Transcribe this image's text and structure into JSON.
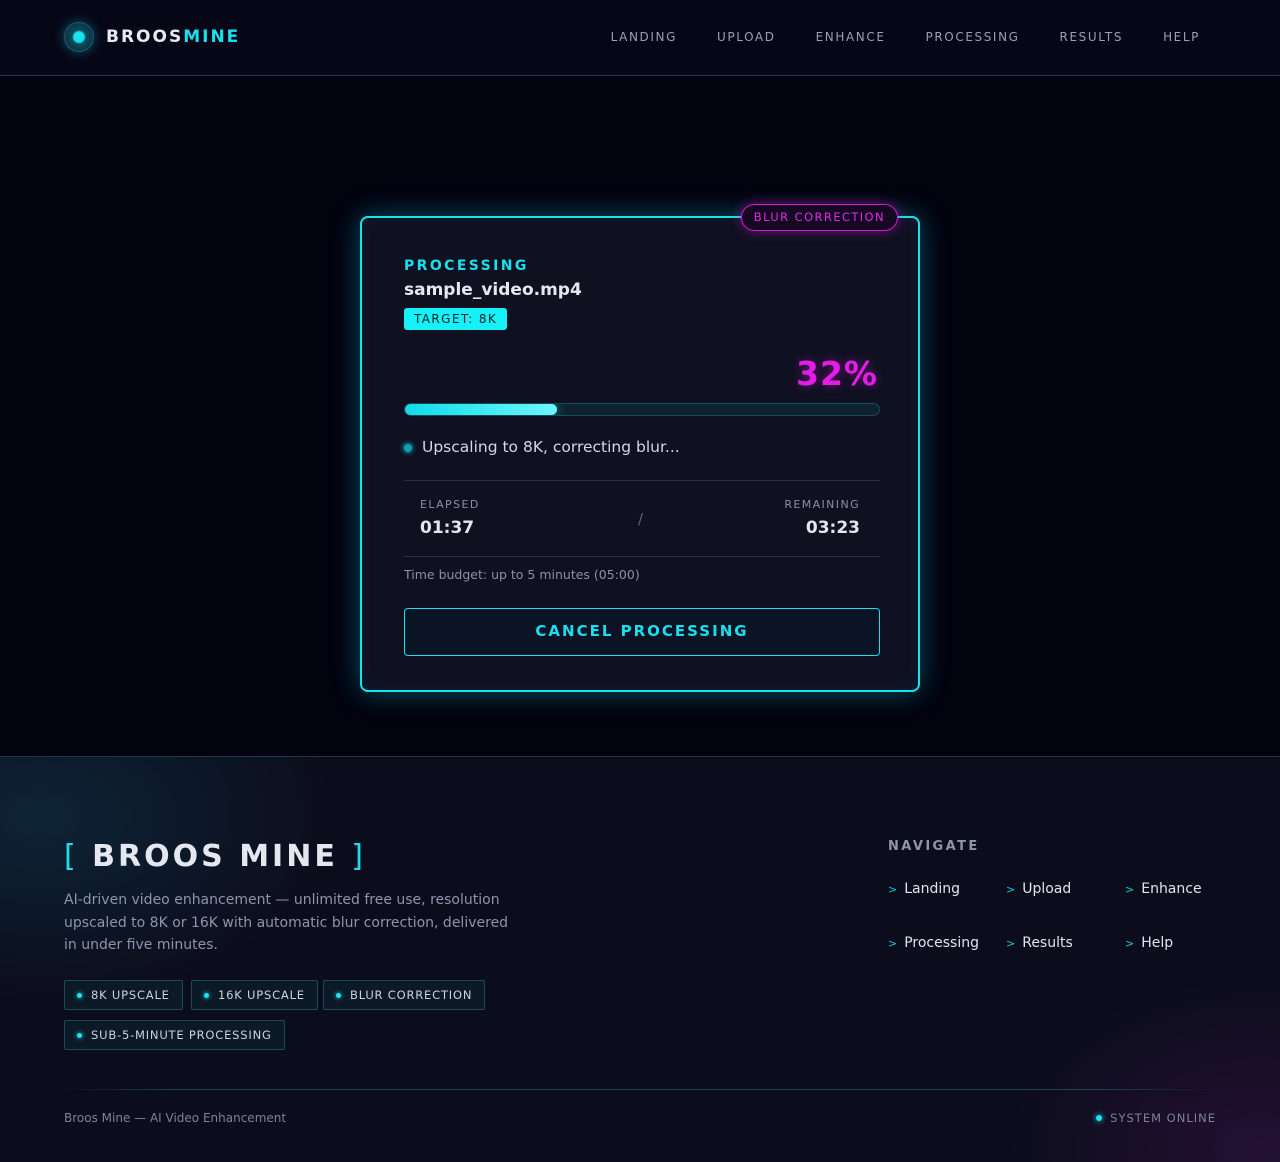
{
  "header": {
    "logo_part1": "BROOS",
    "logo_part2": "MINE",
    "nav": [
      "LANDING",
      "UPLOAD",
      "ENHANCE",
      "PROCESSING",
      "RESULTS",
      "HELP"
    ]
  },
  "card": {
    "tag": "BLUR CORRECTION",
    "label": "PROCESSING",
    "file_name": "sample_video.mp4",
    "target_badge": "TARGET: 8K",
    "percent_text": "32%",
    "progress": 0.32,
    "status": "Upscaling to 8K, correcting blur...",
    "elapsed_label": "ELAPSED",
    "elapsed_value": "01:37",
    "separator": "/",
    "remaining_label": "REMAINING",
    "remaining_value": "03:23",
    "budget": "Time budget: up to 5 minutes (05:00)",
    "cancel_label": "CANCEL PROCESSING"
  },
  "footer": {
    "brand_open": "[",
    "brand_name": "BROOS MINE",
    "brand_close": "]",
    "description": "AI-driven video enhancement — unlimited free use, resolution upscaled to 8K or 16K with automatic blur correction, delivered in under five minutes.",
    "chips": [
      "8K UPSCALE",
      "16K UPSCALE",
      "BLUR CORRECTION",
      "SUB-5-MINUTE PROCESSING"
    ],
    "nav_title": "NAVIGATE",
    "nav_arrow": ">",
    "nav": [
      "Landing",
      "Upload",
      "Enhance",
      "Processing",
      "Results",
      "Help"
    ],
    "copyright": "Broos Mine — AI Video Enhancement",
    "status": "SYSTEM ONLINE"
  },
  "colors": {
    "accent": "#14e3f0",
    "magenta": "#e21ee6",
    "background": "#03020f"
  }
}
